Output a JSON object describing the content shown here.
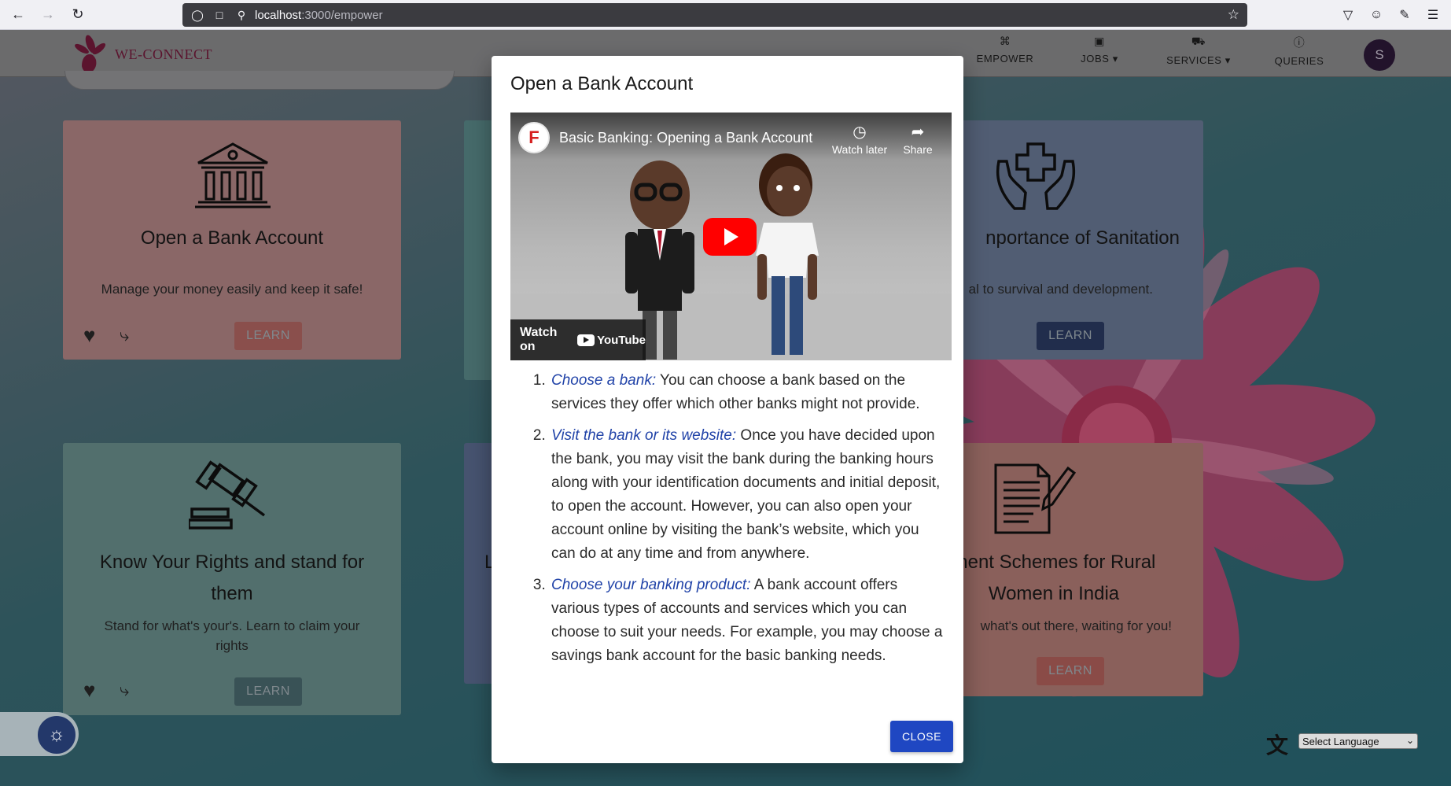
{
  "browser": {
    "url_host": "localhost",
    "url_path": ":3000/empower"
  },
  "header": {
    "brand": "WE-CONNECT",
    "nav": [
      {
        "label": "EMPOWER",
        "icon": "command-icon"
      },
      {
        "label": "JOBS ▾",
        "icon": "briefcase-icon"
      },
      {
        "label": "SERVICES ▾",
        "icon": "cart-icon"
      },
      {
        "label": "QUERIES",
        "icon": "help-circle-icon"
      }
    ],
    "avatar_initial": "S"
  },
  "cards": [
    {
      "title": "Open a Bank Account",
      "desc": "Manage your money easily and keep it safe!",
      "button": "LEARN"
    },
    {
      "title": "nportance of Sanitation",
      "desc": "al to survival and development.",
      "button": "LEARN"
    },
    {
      "title": "Know Your Rights and stand for them",
      "desc": "Stand for what's your's. Learn to claim your rights",
      "button": "LEARN"
    },
    {
      "title": "ment Schemes for Rural Women in India",
      "desc": "what's out there, waiting for you!",
      "button": "LEARN"
    },
    {
      "title": "L"
    }
  ],
  "modal": {
    "title": "Open a Bank Account",
    "video": {
      "title": "Basic Banking: Opening a Bank Account",
      "watch_later": "Watch later",
      "share": "Share",
      "watch_on": "Watch on",
      "youtube": "YouTube"
    },
    "steps": [
      {
        "head": "Choose a bank:",
        "text": " You can choose a bank based on the services they offer which other banks might not provide."
      },
      {
        "head": "Visit the bank or its website:",
        "text": " Once you have decided upon the bank, you may visit the bank during the banking hours along with your identification documents and initial deposit, to open the account. However, you can also open your account online by visiting the bank’s website, which you can do at any time and from anywhere."
      },
      {
        "head": "Choose your banking product:",
        "text": " A bank account offers various types of accounts and services which you can choose to suit your needs. For example, you may choose a savings bank account for the basic banking needs."
      }
    ],
    "close_label": "CLOSE"
  },
  "language": {
    "selected": "Select Language"
  },
  "colors": {
    "accent_blue": "#1f47c2",
    "link_blue": "#2143a8",
    "brand_maroon": "#7a1b3e",
    "youtube_red": "#ff0000"
  }
}
